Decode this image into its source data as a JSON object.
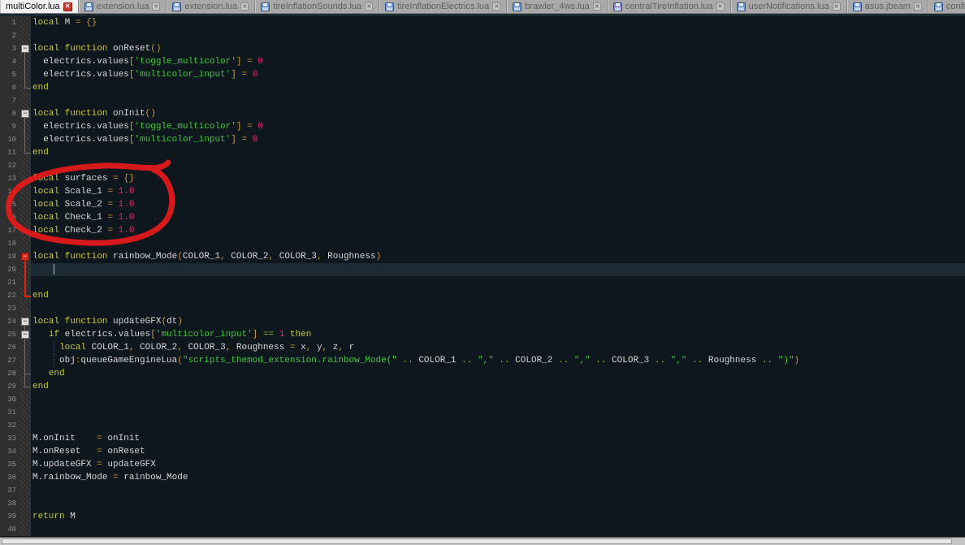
{
  "tabs": [
    {
      "label": "multiColor.lua",
      "active": true,
      "icon": null,
      "close": "red"
    },
    {
      "label": "extension.lua",
      "active": false,
      "icon": "blue",
      "close": "grey"
    },
    {
      "label": "extension.lua",
      "active": false,
      "icon": "blue",
      "close": "grey"
    },
    {
      "label": "tireInflationSounds.lua",
      "active": false,
      "icon": "blue",
      "close": "grey"
    },
    {
      "label": "tireInflationElectrics.lua",
      "active": false,
      "icon": "blue",
      "close": "grey"
    },
    {
      "label": "brawler_4ws.lua",
      "active": false,
      "icon": "blue",
      "close": "grey"
    },
    {
      "label": "centralTireInflation.lua",
      "active": false,
      "icon": "purple",
      "close": "grey"
    },
    {
      "label": "userNotifications.lua",
      "active": false,
      "icon": "blue",
      "close": "grey"
    },
    {
      "label": "asus.jbeam",
      "active": false,
      "icon": "blue",
      "close": "grey"
    },
    {
      "label": "configUserNotifications.lua",
      "active": false,
      "icon": "blue",
      "close": null
    }
  ],
  "colors": {
    "editor_bg": "#0E171D",
    "current_line_bg": "#1C2A33",
    "gutter_bg": "#2F2F2F",
    "keyword": "#C8C832",
    "identifier": "#D6D6D6",
    "string": "#3DC63D",
    "number": "#E8256D",
    "operator": "#C89A3A",
    "operator_green": "#8CC832",
    "annotation_red": "#E51A1A",
    "floppy": {
      "blue": "#6A93CC",
      "purple": "#8F7BC8"
    }
  },
  "editor": {
    "total_lines": 40,
    "current_line": 20,
    "caret": {
      "line": 20,
      "col": 4
    },
    "indent_guide_lines": [
      26,
      27
    ],
    "folds": [
      {
        "line": 3,
        "style": "grey"
      },
      {
        "line": 8,
        "style": "grey"
      },
      {
        "line": 19,
        "style": "red"
      },
      {
        "line": 24,
        "style": "grey"
      },
      {
        "line": 25,
        "style": "grey"
      }
    ],
    "fold_scopes": [
      {
        "from": 3,
        "to": 6,
        "style": "grey"
      },
      {
        "from": 8,
        "to": 11,
        "style": "grey"
      },
      {
        "from": 19,
        "to": 22,
        "style": "red"
      },
      {
        "from": 24,
        "to": 29,
        "style": "grey"
      },
      {
        "from": 25,
        "to": 28,
        "style": "grey"
      }
    ],
    "lines": [
      [
        [
          "kw",
          "local"
        ],
        [
          "id",
          " M "
        ],
        [
          "op",
          "="
        ],
        [
          "id",
          " "
        ],
        [
          "op",
          "{}"
        ]
      ],
      [],
      [
        [
          "kw",
          "local"
        ],
        [
          "id",
          " "
        ],
        [
          "kw",
          "function"
        ],
        [
          "id",
          " onReset"
        ],
        [
          "op",
          "()"
        ]
      ],
      [
        [
          "id",
          "  electrics.values"
        ],
        [
          "op",
          "["
        ],
        [
          "str",
          "'toggle_multicolor'"
        ],
        [
          "op",
          "]"
        ],
        [
          "id",
          " "
        ],
        [
          "op",
          "="
        ],
        [
          "id",
          " "
        ],
        [
          "num",
          "0"
        ]
      ],
      [
        [
          "id",
          "  electrics.values"
        ],
        [
          "op",
          "["
        ],
        [
          "str",
          "'multicolor_input'"
        ],
        [
          "op",
          "]"
        ],
        [
          "id",
          " "
        ],
        [
          "op",
          "="
        ],
        [
          "id",
          " "
        ],
        [
          "num",
          "0"
        ]
      ],
      [
        [
          "kw",
          "end"
        ]
      ],
      [],
      [
        [
          "kw",
          "local"
        ],
        [
          "id",
          " "
        ],
        [
          "kw",
          "function"
        ],
        [
          "id",
          " onInit"
        ],
        [
          "op",
          "()"
        ]
      ],
      [
        [
          "id",
          "  electrics.values"
        ],
        [
          "op",
          "["
        ],
        [
          "str",
          "'toggle_multicolor'"
        ],
        [
          "op",
          "]"
        ],
        [
          "id",
          " "
        ],
        [
          "op",
          "="
        ],
        [
          "id",
          " "
        ],
        [
          "num",
          "0"
        ]
      ],
      [
        [
          "id",
          "  electrics.values"
        ],
        [
          "op",
          "["
        ],
        [
          "str",
          "'multicolor_input'"
        ],
        [
          "op",
          "]"
        ],
        [
          "id",
          " "
        ],
        [
          "op",
          "="
        ],
        [
          "id",
          " "
        ],
        [
          "num",
          "0"
        ]
      ],
      [
        [
          "kw",
          "end"
        ]
      ],
      [],
      [
        [
          "kw",
          "local"
        ],
        [
          "id",
          " surfaces "
        ],
        [
          "op",
          "="
        ],
        [
          "id",
          " "
        ],
        [
          "op",
          "{}"
        ]
      ],
      [
        [
          "kw",
          "local"
        ],
        [
          "id",
          " Scale_1 "
        ],
        [
          "op",
          "="
        ],
        [
          "id",
          " "
        ],
        [
          "num",
          "1.0"
        ]
      ],
      [
        [
          "kw",
          "local"
        ],
        [
          "id",
          " Scale_2 "
        ],
        [
          "op",
          "="
        ],
        [
          "id",
          " "
        ],
        [
          "num",
          "1.0"
        ]
      ],
      [
        [
          "kw",
          "local"
        ],
        [
          "id",
          " Check_1 "
        ],
        [
          "op",
          "="
        ],
        [
          "id",
          " "
        ],
        [
          "num",
          "1.0"
        ]
      ],
      [
        [
          "kw",
          "local"
        ],
        [
          "id",
          " Check_2 "
        ],
        [
          "op",
          "="
        ],
        [
          "id",
          " "
        ],
        [
          "num",
          "1.0"
        ]
      ],
      [],
      [
        [
          "kw",
          "local"
        ],
        [
          "id",
          " "
        ],
        [
          "kw",
          "function"
        ],
        [
          "id",
          " rainbow_Mode"
        ],
        [
          "op",
          "("
        ],
        [
          "id",
          "COLOR_1"
        ],
        [
          "op",
          ","
        ],
        [
          "id",
          " COLOR_2"
        ],
        [
          "op",
          ","
        ],
        [
          "id",
          " COLOR_3"
        ],
        [
          "op",
          ","
        ],
        [
          "id",
          " Roughness"
        ],
        [
          "op",
          ")"
        ]
      ],
      [],
      [],
      [
        [
          "kw",
          "end"
        ]
      ],
      [],
      [
        [
          "kw",
          "local"
        ],
        [
          "id",
          " "
        ],
        [
          "kw",
          "function"
        ],
        [
          "id",
          " updateGFX"
        ],
        [
          "op",
          "("
        ],
        [
          "id",
          "dt"
        ],
        [
          "op",
          ")"
        ]
      ],
      [
        [
          "id",
          "   "
        ],
        [
          "kw",
          "if"
        ],
        [
          "id",
          " electrics.values"
        ],
        [
          "op",
          "["
        ],
        [
          "str",
          "'multicolor_input'"
        ],
        [
          "op",
          "]"
        ],
        [
          "id",
          " "
        ],
        [
          "opg",
          "=="
        ],
        [
          "id",
          " "
        ],
        [
          "num",
          "1"
        ],
        [
          "id",
          " "
        ],
        [
          "kw",
          "then"
        ]
      ],
      [
        [
          "id",
          "     "
        ],
        [
          "kw",
          "local"
        ],
        [
          "id",
          " COLOR_1"
        ],
        [
          "op",
          ","
        ],
        [
          "id",
          " COLOR_2"
        ],
        [
          "op",
          ","
        ],
        [
          "id",
          " COLOR_3"
        ],
        [
          "op",
          ","
        ],
        [
          "id",
          " Roughness "
        ],
        [
          "op",
          "="
        ],
        [
          "id",
          " x"
        ],
        [
          "op",
          ","
        ],
        [
          "id",
          " y"
        ],
        [
          "op",
          ","
        ],
        [
          "id",
          " z"
        ],
        [
          "op",
          ","
        ],
        [
          "id",
          " r"
        ]
      ],
      [
        [
          "id",
          "     obj"
        ],
        [
          "op",
          ":"
        ],
        [
          "id",
          "queueGameEngineLua"
        ],
        [
          "op",
          "("
        ],
        [
          "str",
          "\"scripts_themod_extension.rainbow_Mode(\""
        ],
        [
          "id",
          " "
        ],
        [
          "opg",
          ".."
        ],
        [
          "id",
          " COLOR_1 "
        ],
        [
          "opg",
          ".."
        ],
        [
          "id",
          " "
        ],
        [
          "str",
          "\",\""
        ],
        [
          "id",
          " "
        ],
        [
          "opg",
          ".."
        ],
        [
          "id",
          " COLOR_2 "
        ],
        [
          "opg",
          ".."
        ],
        [
          "id",
          " "
        ],
        [
          "str",
          "\",\""
        ],
        [
          "id",
          " "
        ],
        [
          "opg",
          ".."
        ],
        [
          "id",
          " COLOR_3 "
        ],
        [
          "opg",
          ".."
        ],
        [
          "id",
          " "
        ],
        [
          "str",
          "\",\""
        ],
        [
          "id",
          " "
        ],
        [
          "opg",
          ".."
        ],
        [
          "id",
          " Roughness "
        ],
        [
          "opg",
          ".."
        ],
        [
          "id",
          " "
        ],
        [
          "str",
          "\")\""
        ],
        [
          "op",
          ")"
        ]
      ],
      [
        [
          "id",
          "   "
        ],
        [
          "kw",
          "end"
        ]
      ],
      [
        [
          "kw",
          "end"
        ]
      ],
      [],
      [],
      [],
      [
        [
          "id",
          "M.onInit    "
        ],
        [
          "op",
          "="
        ],
        [
          "id",
          " onInit"
        ]
      ],
      [
        [
          "id",
          "M.onReset   "
        ],
        [
          "op",
          "="
        ],
        [
          "id",
          " onReset"
        ]
      ],
      [
        [
          "id",
          "M.updateGFX "
        ],
        [
          "op",
          "="
        ],
        [
          "id",
          " updateGFX"
        ]
      ],
      [
        [
          "id",
          "M.rainbow_Mode "
        ],
        [
          "op",
          "="
        ],
        [
          "id",
          " rainbow_Mode"
        ]
      ],
      [],
      [],
      [
        [
          "kw",
          "return"
        ],
        [
          "id",
          " M"
        ]
      ],
      []
    ]
  },
  "annotation": {
    "shape": "hand-drawn-ellipse",
    "color": "#E51A1A",
    "stroke_width": 7,
    "circled_lines": [
      13,
      17
    ]
  }
}
